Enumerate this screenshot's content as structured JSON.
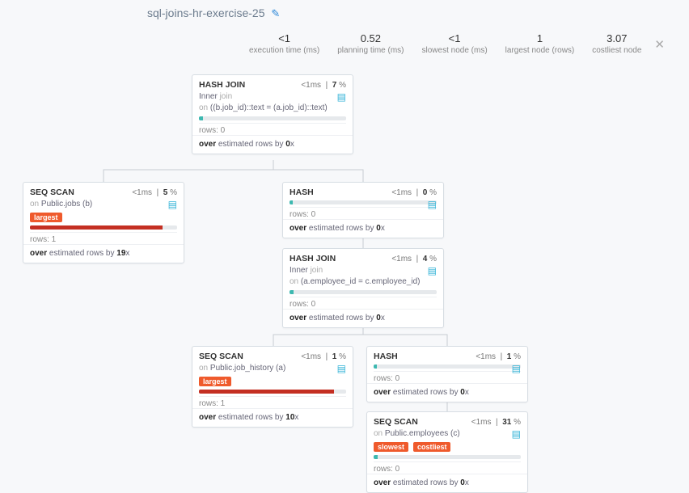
{
  "title": "sql-joins-hr-exercise-25",
  "stats": [
    {
      "val": "<1",
      "lbl": "execution time (ms)"
    },
    {
      "val": "0.52",
      "lbl": "planning time (ms)"
    },
    {
      "val": "<1",
      "lbl": "slowest node (ms)"
    },
    {
      "val": "1",
      "lbl": "largest node (rows)"
    },
    {
      "val": "3.07",
      "lbl": "costliest node"
    }
  ],
  "labels": {
    "rows_prefix": "rows: ",
    "on_prefix": "on",
    "over_prefix": "over",
    "est_text": " estimated rows by "
  },
  "nodes": {
    "n1": {
      "name": "HASH JOIN",
      "time": "<1",
      "pct": "7",
      "sub1": "Inner",
      "sub1dim": " join",
      "sub2_on": " ((b.job_id)::text = (a.job_id)::text)",
      "rows": "0",
      "est": "0",
      "estx": "x"
    },
    "n2": {
      "name": "SEQ SCAN",
      "time": "<1",
      "pct": "5",
      "sub2_on": " Public.jobs (b)",
      "badge1": "largest",
      "rows": "1",
      "est": "19",
      "estx": "x"
    },
    "n3": {
      "name": "HASH",
      "time": "<1",
      "pct": "0",
      "rows": "0",
      "est": "0",
      "estx": "x"
    },
    "n4": {
      "name": "HASH JOIN",
      "time": "<1",
      "pct": "4",
      "sub1": "Inner",
      "sub1dim": " join",
      "sub2_on": " (a.employee_id = c.employee_id)",
      "rows": "0",
      "est": "0",
      "estx": "x"
    },
    "n5": {
      "name": "SEQ SCAN",
      "time": "<1",
      "pct": "1",
      "sub2_on": " Public.job_history (a)",
      "badge1": "largest",
      "rows": "1",
      "est": "10",
      "estx": "x"
    },
    "n6": {
      "name": "HASH",
      "time": "<1",
      "pct": "1",
      "rows": "0",
      "est": "0",
      "estx": "x"
    },
    "n7": {
      "name": "SEQ SCAN",
      "time": "<1",
      "pct": "31",
      "sub2_on": " Public.employees (c)",
      "badge1": "slowest",
      "badge2": "costliest",
      "rows": "0",
      "est": "0",
      "estx": "x"
    }
  }
}
